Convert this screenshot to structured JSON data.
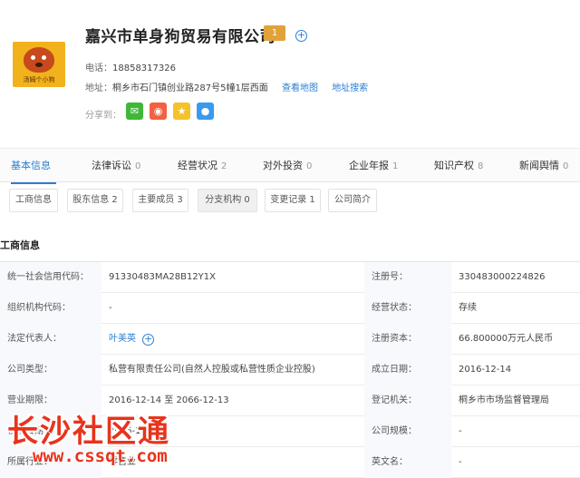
{
  "company": {
    "logo_text": "汤姆个小狗",
    "name": "嘉兴市单身狗贸易有限公司",
    "badge": "1",
    "phone_label": "电话：",
    "phone": "18858317326",
    "address_label": "地址：",
    "address": "桐乡市石门镇创业路287号5幢1层西面",
    "view_map": "查看地图",
    "address_search": "地址搜索",
    "share_label": "分享到：",
    "share_icons": [
      "wechat-icon",
      "weibo-icon",
      "star-icon",
      "qq-icon"
    ]
  },
  "tabs": [
    {
      "label": "基本信息",
      "count": ""
    },
    {
      "label": "法律诉讼",
      "count": "0"
    },
    {
      "label": "经营状况",
      "count": "2"
    },
    {
      "label": "对外投资",
      "count": "0"
    },
    {
      "label": "企业年报",
      "count": "1"
    },
    {
      "label": "知识产权",
      "count": "8"
    },
    {
      "label": "新闻舆情",
      "count": "0"
    }
  ],
  "subtabs": [
    "工商信息",
    "股东信息 2",
    "主要成员 3",
    "分支机构 0",
    "变更记录 1",
    "公司简介"
  ],
  "section_title": "工商信息",
  "rows": [
    {
      "l1": "统一社会信用代码：",
      "v1": "91330483MA28B12Y1X",
      "l2": "注册号：",
      "v2": "330483000224826"
    },
    {
      "l1": "组织机构代码：",
      "v1": "-",
      "l2": "经营状态：",
      "v2": "存续"
    },
    {
      "l1": "法定代表人：",
      "v1": "叶美英",
      "l2": "注册资本：",
      "v2": "66.800000万元人民币"
    },
    {
      "l1": "公司类型：",
      "v1": "私营有限责任公司(自然人控股或私营性质企业控股)",
      "l2": "成立日期：",
      "v2": "2016-12-14"
    },
    {
      "l1": "营业期限：",
      "v1": "2016-12-14 至 2066-12-13",
      "l2": "登记机关：",
      "v2": "桐乡市市场监督管理局"
    },
    {
      "l1": "核准日期：",
      "v1": "2016-12-14",
      "l2": "公司规模：",
      "v2": "-"
    },
    {
      "l1": "所属行业：",
      "v1": "零售业",
      "l2": "英文名：",
      "v2": "-"
    }
  ],
  "watermark": {
    "title": "长沙社区通",
    "url": "www.cssqt.com"
  },
  "colors": {
    "accent": "#2a7fd4",
    "badge": "#e0a33a",
    "watermark": "#e8331d"
  }
}
